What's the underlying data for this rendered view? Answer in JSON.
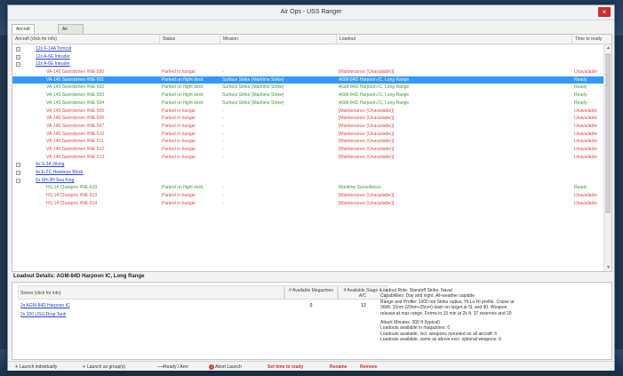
{
  "window": {
    "title": "Air Ops - USS Ranger",
    "close_glyph": "×"
  },
  "tabs": [
    {
      "label": "Aircraft Status",
      "active": true
    },
    {
      "label": "Air Facilities",
      "active": false
    }
  ],
  "table": {
    "headers": {
      "name": "Aircraft (click for info)",
      "status": "Status",
      "mission": "Mission",
      "loadout": "Loadout",
      "ready": "Time to ready"
    },
    "rows": [
      {
        "kind": "group",
        "expander": "+",
        "name": "12x F-14A Tomcat"
      },
      {
        "kind": "group",
        "expander": "+",
        "name": "12x A-6E Intruder"
      },
      {
        "kind": "group",
        "expander": "−",
        "name": "12x A-6E Intruder"
      },
      {
        "kind": "aircraft",
        "color": "red",
        "name": "VA-145 Swordsmen #NE-500",
        "status": "Parked in hangar",
        "mission": "-",
        "loadout": "[Maintenance (Unavailable)]",
        "ready": "Unavailable"
      },
      {
        "kind": "aircraft",
        "color": "green",
        "selected": true,
        "name": "VA-145 Swordsmen #NE-501",
        "status": "Parked on flight deck",
        "mission": "Surface Strike (Maritime Strike)",
        "loadout": "AGM-84D Harpoon IC, Long Range",
        "ready": "Ready"
      },
      {
        "kind": "aircraft",
        "color": "green",
        "name": "VA-145 Swordsmen #NE-502",
        "status": "Parked on flight deck",
        "mission": "Surface Strike (Maritime Strike)",
        "loadout": "AGM-84D Harpoon IC, Long Range",
        "ready": "Ready"
      },
      {
        "kind": "aircraft",
        "color": "green",
        "name": "VA-145 Swordsmen #NE-503",
        "status": "Parked on flight deck",
        "mission": "Surface Strike (Maritime Strike)",
        "loadout": "AGM-84D Harpoon IC, Long Range",
        "ready": "Ready"
      },
      {
        "kind": "aircraft",
        "color": "green",
        "name": "VA-145 Swordsmen #NE-504",
        "status": "Parked on flight deck",
        "mission": "Surface Strike (Maritime Strike)",
        "loadout": "AGM-84D Harpoon IC, Long Range",
        "ready": "Ready"
      },
      {
        "kind": "aircraft",
        "color": "red",
        "name": "VA-145 Swordsmen #NE-505",
        "status": "Parked in hangar",
        "mission": "-",
        "loadout": "[Maintenance (Unavailable)]",
        "ready": "Unavailable"
      },
      {
        "kind": "aircraft",
        "color": "red",
        "name": "VA-145 Swordsmen #NE-506",
        "status": "Parked in hangar",
        "mission": "-",
        "loadout": "[Maintenance (Unavailable)]",
        "ready": "Unavailable"
      },
      {
        "kind": "aircraft",
        "color": "red",
        "name": "VA-145 Swordsmen #NE-507",
        "status": "Parked in hangar",
        "mission": "-",
        "loadout": "[Maintenance (Unavailable)]",
        "ready": "Unavailable"
      },
      {
        "kind": "aircraft",
        "color": "red",
        "name": "VA-145 Swordsmen #NE-510",
        "status": "Parked in hangar",
        "mission": "-",
        "loadout": "[Maintenance (Unavailable)]",
        "ready": "Unavailable"
      },
      {
        "kind": "aircraft",
        "color": "red",
        "name": "VA-145 Swordsmen #NE-511",
        "status": "Parked in hangar",
        "mission": "-",
        "loadout": "[Maintenance (Unavailable)]",
        "ready": "Unavailable"
      },
      {
        "kind": "aircraft",
        "color": "red",
        "name": "VA-145 Swordsmen #NE-512",
        "status": "Parked in hangar",
        "mission": "-",
        "loadout": "[Maintenance (Unavailable)]",
        "ready": "Unavailable"
      },
      {
        "kind": "aircraft",
        "color": "red",
        "name": "VA-145 Swordsmen #NE-513",
        "status": "Parked in hangar",
        "mission": "-",
        "loadout": "[Maintenance (Unavailable)]",
        "ready": "Unavailable"
      },
      {
        "kind": "group",
        "expander": "+",
        "name": "4x S-3A Viking"
      },
      {
        "kind": "group",
        "expander": "+",
        "name": "4x E-2C Hawkeye Block"
      },
      {
        "kind": "group",
        "expander": "−",
        "name": "6x SH-3H Sea King"
      },
      {
        "kind": "aircraft",
        "color": "green",
        "name": "HS-14 Chargers #NE-610",
        "status": "Parked on flight deck",
        "mission": "-",
        "loadout": "Maritime Surveillance",
        "ready": "Ready"
      },
      {
        "kind": "aircraft",
        "color": "red",
        "name": "HS-14 Chargers #NE-613",
        "status": "Parked in hangar",
        "mission": "-",
        "loadout": "[Maintenance (Unavailable)]",
        "ready": "Unavailable"
      },
      {
        "kind": "aircraft",
        "color": "red",
        "name": "HS-14 Chargers #NE-614",
        "status": "Parked in hangar",
        "mission": "-",
        "loadout": "[Maintenance (Unavailable)]",
        "ready": "Unavailable"
      }
    ]
  },
  "details": {
    "title_label": "Loadout Details:",
    "title_value": "AGM-84D Harpoon IC, Long Range",
    "columns": {
      "name": "Stores (click for info)",
      "magazine": "# Available Magazines",
      "available": "# Available Stage + A/C"
    },
    "weapons": [
      {
        "name": "2x AGM-84D Harpoon IC",
        "magazine": "0",
        "available": "12"
      },
      {
        "name": "2x 300 USG Drop Tank",
        "magazine": "",
        "available": ""
      }
    ],
    "notes": [
      "Loadout Role: Standoff Strike: Naval",
      "Capabilities: Day and night, All-weather capable",
      "Range and Profile: 1000 nm Strike radius, Hi-Lo-Hi profile. Cruise at",
      "36kft. 10nm (20nm+25nm) dash on target at 5L and 90. Weapon",
      "release at max range. Forms in 15 min at 2k ft. 37 reserves and 20",
      "",
      "Attack Minutes: 300 ft (typical)",
      "Loadouts available in magazines: 0",
      "Loadouts available, incl. weapons mounted on all aircraft: 6",
      "Loadouts available, same as above excl. optional weapons: 6"
    ]
  },
  "footer": {
    "launch_individually": "Launch individually",
    "launch_group": "Launch as group(s)",
    "ready_arm": "Ready / Arm",
    "abort_launch": "Abort Launch",
    "set_time_ready": "Set time to ready",
    "rename": "Rename",
    "remove": "Remove",
    "plane_glyph": "✈",
    "arrow_glyph": "⟶",
    "abort_glyph": "!"
  },
  "colors": {
    "red_text": "#e04a4a",
    "green_text": "#3a9a3a",
    "link_blue": "#2a44c4",
    "selection": "#3399ff",
    "close_button": "#c9302c"
  }
}
